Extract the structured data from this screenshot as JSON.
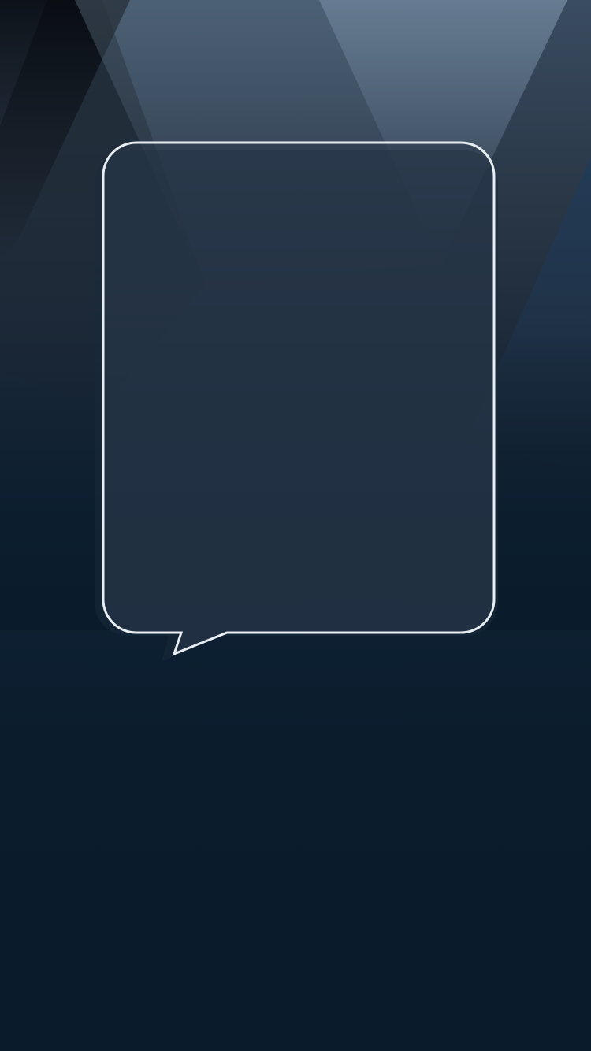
{
  "screen": {
    "title": "",
    "background_color": "#0a1c2b",
    "accent_color": "#6a829a"
  },
  "speech_bubble": {
    "icon": "speech-bubble-icon",
    "text": "",
    "outline_color": "#e8edf2",
    "fill_color": "#2b3b4c"
  }
}
